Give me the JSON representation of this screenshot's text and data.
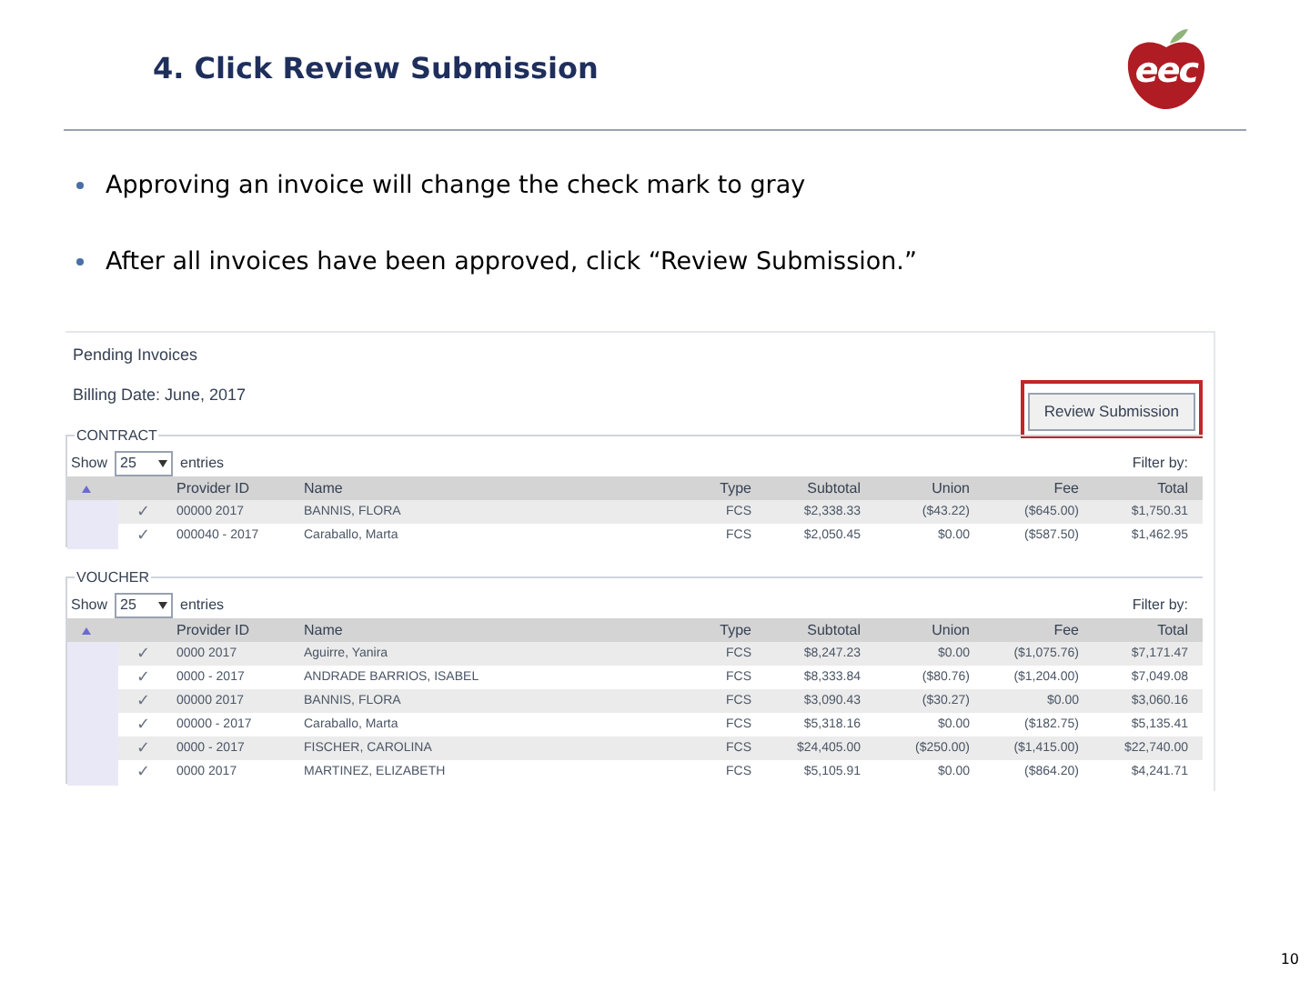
{
  "slide": {
    "title": "4. Click Review Submission",
    "logo": "eec",
    "page_number": "10"
  },
  "bullets": [
    "Approving an invoice will change the check mark to gray",
    "After all invoices have been approved, click “Review Submission.”"
  ],
  "screenshot": {
    "heading": "Pending Invoices",
    "billing_date": "Billing Date: June, 2017",
    "review_button": "Review Submission",
    "sections": [
      {
        "legend": "CONTRACT",
        "show": "Show",
        "entries_value": "25",
        "entries": "entries",
        "filter": "Filter by:",
        "columns": [
          "Provider ID",
          "Name",
          "Type",
          "Subtotal",
          "Union",
          "Fee",
          "Total"
        ],
        "rows": [
          {
            "check": "✓",
            "cells": [
              "00000 2017",
              "BANNIS, FLORA",
              "FCS",
              "$2,338.33",
              "($43.22)",
              "($645.00)",
              "$1,750.31"
            ]
          },
          {
            "check": "✓",
            "cells": [
              "000040 - 2017",
              "Caraballo, Marta",
              "FCS",
              "$2,050.45",
              "$0.00",
              "($587.50)",
              "$1,462.95"
            ]
          }
        ]
      },
      {
        "legend": "VOUCHER",
        "show": "Show",
        "entries_value": "25",
        "entries": "entries",
        "filter": "Filter by:",
        "columns": [
          "Provider ID",
          "Name",
          "Type",
          "Subtotal",
          "Union",
          "Fee",
          "Total"
        ],
        "rows": [
          {
            "check": "✓",
            "cells": [
              "0000 2017",
              "Aguirre, Yanira",
              "FCS",
              "$8,247.23",
              "$0.00",
              "($1,075.76)",
              "$7,171.47"
            ]
          },
          {
            "check": "✓",
            "cells": [
              "0000 - 2017",
              "ANDRADE BARRIOS, ISABEL",
              "FCS",
              "$8,333.84",
              "($80.76)",
              "($1,204.00)",
              "$7,049.08"
            ]
          },
          {
            "check": "✓",
            "cells": [
              "00000 2017",
              "BANNIS, FLORA",
              "FCS",
              "$3,090.43",
              "($30.27)",
              "$0.00",
              "$3,060.16"
            ]
          },
          {
            "check": "✓",
            "cells": [
              "00000 - 2017",
              "Caraballo, Marta",
              "FCS",
              "$5,318.16",
              "$0.00",
              "($182.75)",
              "$5,135.41"
            ]
          },
          {
            "check": "✓",
            "cells": [
              "0000 - 2017",
              "FISCHER, CAROLINA",
              "FCS",
              "$24,405.00",
              "($250.00)",
              "($1,415.00)",
              "$22,740.00"
            ]
          },
          {
            "check": "✓",
            "cells": [
              "0000 2017",
              "MARTINEZ, ELIZABETH",
              "FCS",
              "$5,105.91",
              "$0.00",
              "($864.20)",
              "$4,241.71"
            ]
          }
        ]
      }
    ]
  }
}
